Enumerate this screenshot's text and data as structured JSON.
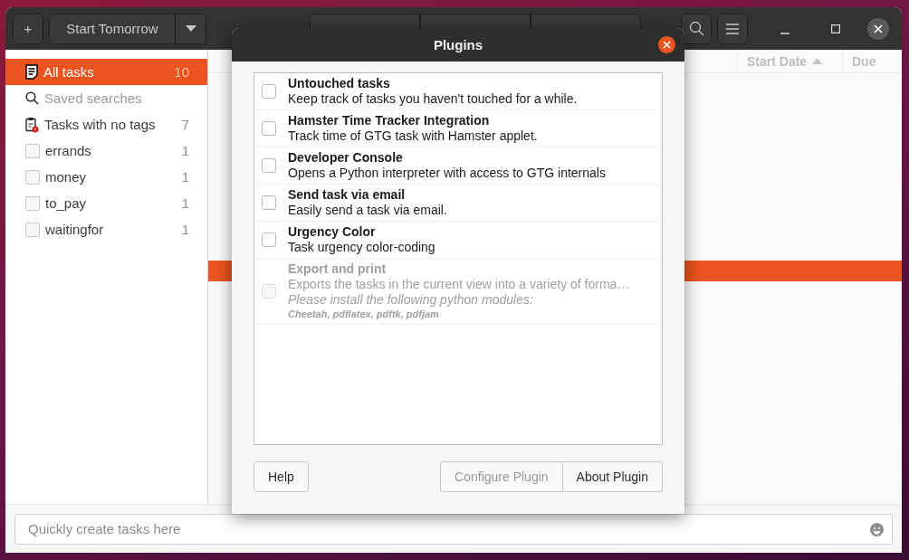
{
  "header": {
    "add_button": "+",
    "start_button": "Start Tomorrow"
  },
  "sidebar": {
    "items": [
      {
        "kind": "all",
        "label": "All tasks",
        "count": "10",
        "selected": true,
        "disabled": false
      },
      {
        "kind": "search",
        "label": "Saved searches",
        "selected": false,
        "disabled": true
      },
      {
        "kind": "notag",
        "label": "Tasks with no tags",
        "count": "7",
        "selected": false,
        "disabled": false
      },
      {
        "kind": "tag",
        "label": "errands",
        "count": "1",
        "selected": false,
        "disabled": false
      },
      {
        "kind": "tag",
        "label": "money",
        "count": "1",
        "selected": false,
        "disabled": false
      },
      {
        "kind": "tag",
        "label": "to_pay",
        "count": "1",
        "selected": false,
        "disabled": false
      },
      {
        "kind": "tag",
        "label": "waitingfor",
        "count": "1",
        "selected": false,
        "disabled": false
      }
    ]
  },
  "task_list": {
    "columns": [
      {
        "label": "Start Date",
        "sorted": true
      },
      {
        "label": "Due",
        "sorted": false
      }
    ]
  },
  "quick_add": {
    "placeholder": "Quickly create tasks here"
  },
  "dialog": {
    "title": "Plugins",
    "plugins": [
      {
        "name": "Untouched tasks",
        "description": "Keep track of tasks you haven't touched for a while.",
        "checked": false,
        "disabled": false
      },
      {
        "name": "Hamster Time Tracker Integration",
        "description": "Track time of GTG task with Hamster applet.",
        "checked": false,
        "disabled": false
      },
      {
        "name": "Developer Console",
        "description": "Opens a Python interpreter with access to GTG internals",
        "checked": false,
        "disabled": false
      },
      {
        "name": "Send task via email",
        "description": "Easily send a task via email.",
        "checked": false,
        "disabled": false
      },
      {
        "name": "Urgency Color",
        "description": "Task urgency color-coding",
        "checked": false,
        "disabled": false
      },
      {
        "name": "Export and print",
        "description": "Exports the tasks in the current view into a variety of forma…",
        "note": "Please install the following python modules:",
        "modules": "Cheetah, pdflatex, pdftk, pdfjam",
        "checked": false,
        "disabled": true
      }
    ],
    "buttons": [
      {
        "label": "Help",
        "disabled": false
      },
      {
        "label": "Configure Plugin",
        "disabled": true
      },
      {
        "label": "About Plugin",
        "disabled": false
      }
    ]
  }
}
